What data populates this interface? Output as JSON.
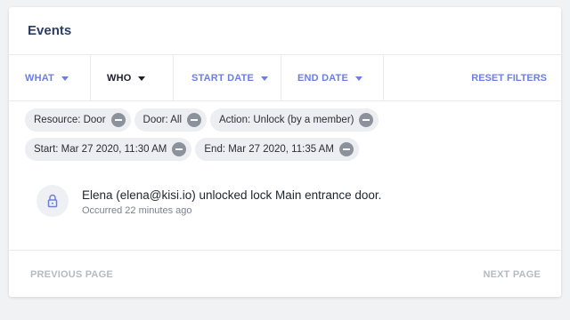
{
  "card": {
    "title": "Events"
  },
  "filters": {
    "tabs": [
      {
        "label": "WHAT",
        "active": false
      },
      {
        "label": "WHO",
        "active": true
      },
      {
        "label": "START DATE",
        "active": false
      },
      {
        "label": "END DATE",
        "active": false
      }
    ],
    "reset_label": "RESET FILTERS"
  },
  "chips": [
    {
      "label": "Resource: Door"
    },
    {
      "label": "Door: All"
    },
    {
      "label": "Action: Unlock (by a member)"
    },
    {
      "label": "Start: Mar 27 2020, 11:30 AM"
    },
    {
      "label": "End: Mar 27 2020, 11:35 AM"
    }
  ],
  "event": {
    "icon": "lock-icon",
    "message": "Elena (elena@kisi.io) unlocked lock Main entrance door.",
    "time": "Occurred 22 minutes ago"
  },
  "pager": {
    "previous_label": "PREVIOUS PAGE",
    "next_label": "NEXT PAGE"
  },
  "colors": {
    "accent": "#6b7fe0",
    "title": "#2d3e63",
    "chip_bg": "#eceef1",
    "disabled": "#b6bac2"
  }
}
